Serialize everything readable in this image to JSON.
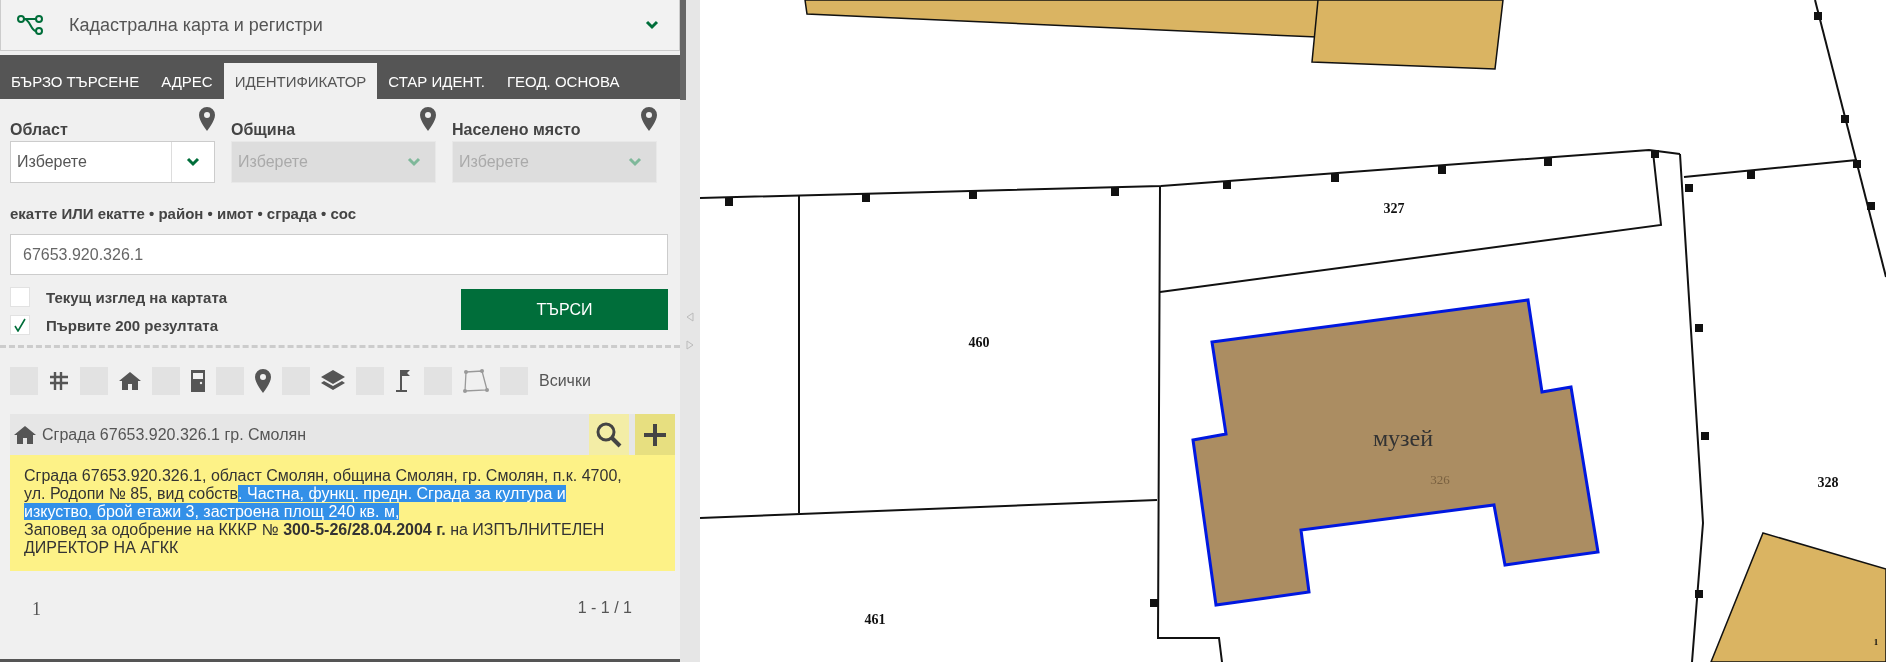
{
  "app_header": {
    "title": "Кадастрална карта и регистри"
  },
  "tabs": [
    {
      "label": "БЪРЗО ТЪРСЕНЕ",
      "selected": false
    },
    {
      "label": "АДРЕС",
      "selected": false
    },
    {
      "label": "ИДЕНТИФИКАТОР",
      "selected": true
    },
    {
      "label": "СТАР ИДЕНТ.",
      "selected": false
    },
    {
      "label": "ГЕОД. ОСНОВА",
      "selected": false
    }
  ],
  "location_filters": [
    {
      "label": "Област",
      "placeholder": "Изберете",
      "disabled": false
    },
    {
      "label": "Община",
      "placeholder": "Изберете",
      "disabled": true
    },
    {
      "label": "Населено място",
      "placeholder": "Изберете",
      "disabled": true
    }
  ],
  "identifier": {
    "label": "екатте ИЛИ екатте • район • имот • сграда • сос",
    "value": "67653.920.326.1"
  },
  "options": [
    {
      "label": "Текущ изглед на картата",
      "checked": false
    },
    {
      "label": "Първите 200 резултата",
      "checked": true
    }
  ],
  "search_button": "ТЪРСИ",
  "type_filters": [
    {
      "kind": "grid",
      "checked": false
    },
    {
      "kind": "home",
      "checked": false
    },
    {
      "kind": "building",
      "checked": false
    },
    {
      "kind": "pin",
      "checked": false
    },
    {
      "kind": "layers",
      "checked": false
    },
    {
      "kind": "flag",
      "checked": false
    },
    {
      "kind": "polygon",
      "checked": false
    }
  ],
  "all_filter": {
    "label": "Всички",
    "checked": false
  },
  "result": {
    "kind": "home",
    "title": "Сграда 67653.920.326.1 гр. Смолян",
    "paragraphs": [
      [
        {
          "text": "Сграда 67653.920.326.1, област Смолян, община Смолян, гр. Смолян, п.к. 4700, ул. Родопи № 85, вид собств",
          "highlighted": false
        },
        {
          "text": ". Частна, функц. предн. Сграда за култура и изкуство, брой етажи 3, застроена площ 240 кв. м,",
          "highlighted": true
        }
      ],
      [
        {
          "text": "Заповед за одобрение на КККР № **300-5-26/28.04.2004 г.** на ИЗПЪЛНИТЕЛЕН ДИРЕКТОР НА АГКК",
          "highlighted": false
        }
      ]
    ]
  },
  "pagination": {
    "page": "1",
    "range": "1 - 1 / 1"
  },
  "map": {
    "parcel_numbers": [
      "327",
      "460",
      "461",
      "328",
      "1"
    ],
    "building": {
      "name": "музей",
      "number": "326"
    }
  }
}
